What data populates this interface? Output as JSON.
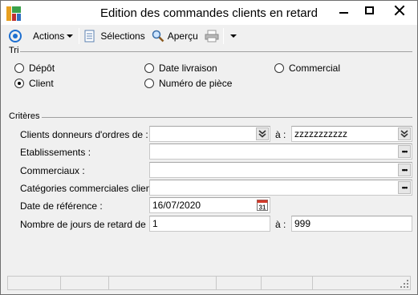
{
  "window": {
    "title": "Edition des commandes clients en retard",
    "controls": {
      "minimize": "minimize-icon",
      "maximize": "maximize-icon",
      "close": "close-icon"
    }
  },
  "toolbar": {
    "actions_label": "Actions",
    "selections_label": "Sélections",
    "apercu_label": "Aperçu"
  },
  "tri": {
    "label": "Tri",
    "options": {
      "depot": "Dépôt",
      "date_livraison": "Date livraison",
      "commercial": "Commercial",
      "client": "Client",
      "numero_piece": "Numéro de pièce"
    },
    "selected": "Client"
  },
  "criteres": {
    "label": "Critères",
    "a_label": "à :",
    "clients_donneurs": {
      "label": "Clients donneurs d'ordres de :",
      "from_value": "",
      "to_value": "zzzzzzzzzzz"
    },
    "etablissements": {
      "label": "Etablissements :",
      "value": ""
    },
    "commerciaux": {
      "label": "Commerciaux :",
      "value": ""
    },
    "categories": {
      "label": "Catégories commerciales clients :",
      "value": ""
    },
    "date_reference": {
      "label": "Date de référence :",
      "value": "16/07/2020",
      "calendar_day": "31"
    },
    "jours_retard": {
      "label": "Nombre de jours de retard de :",
      "from_value": "1",
      "to_value": "999"
    }
  },
  "colors": {
    "accent": "#1e6fd0",
    "window_bg": "#f0f0f0",
    "border": "#a0a0a0"
  }
}
